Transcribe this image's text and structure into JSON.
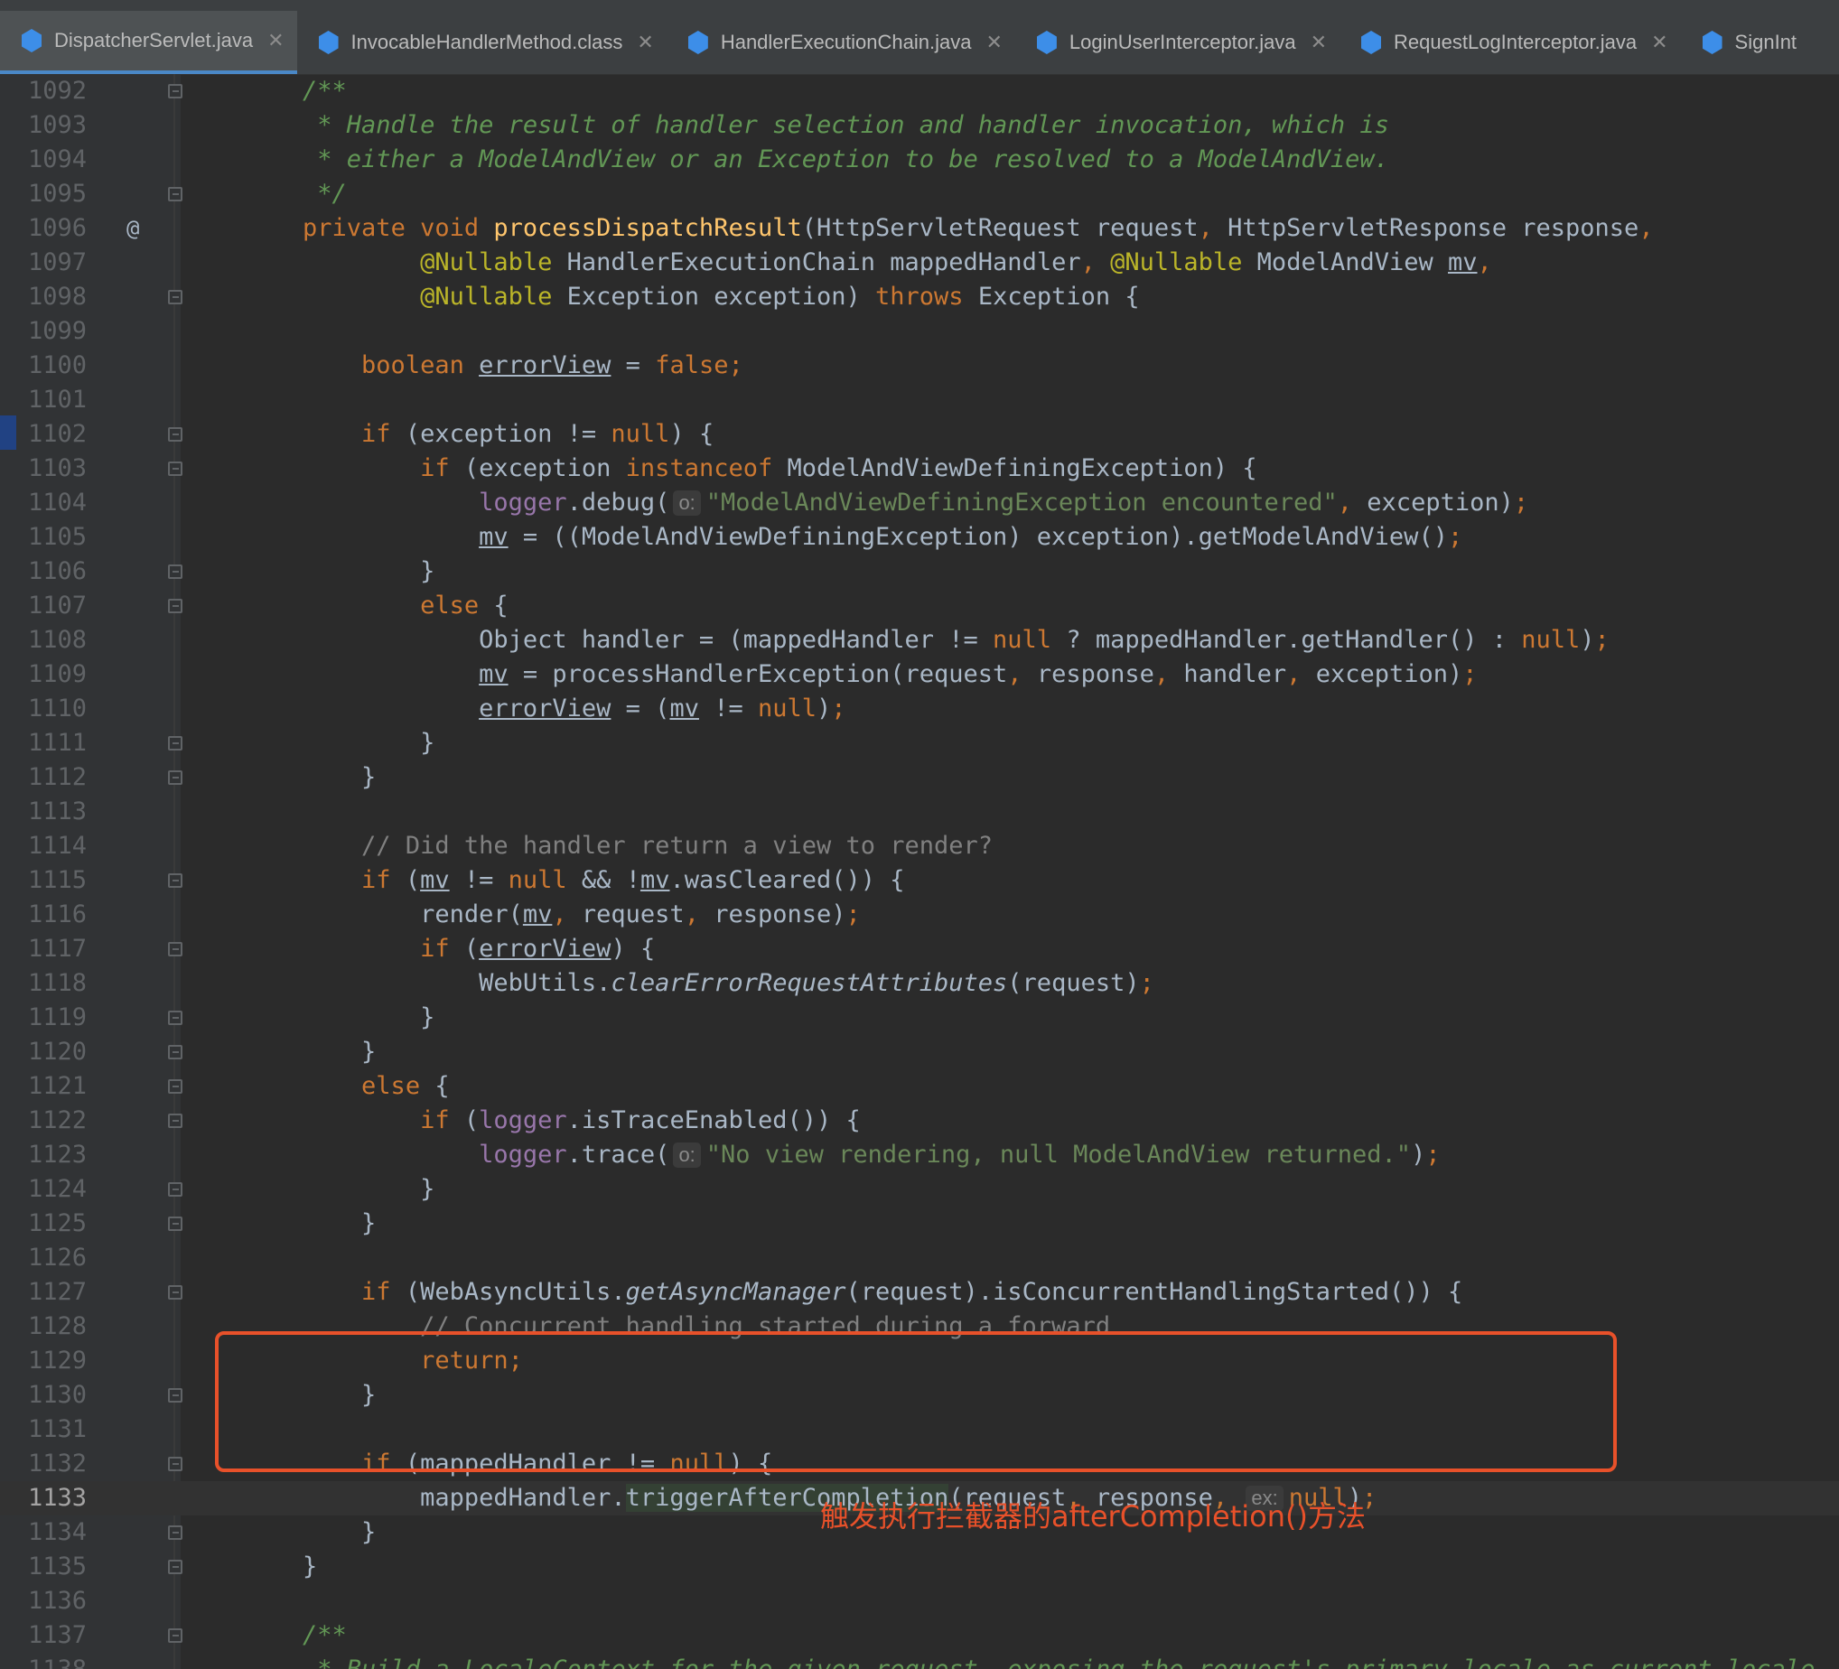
{
  "tabs": [
    {
      "label": "DispatcherServlet.java",
      "active": true,
      "closable": true
    },
    {
      "label": "InvocableHandlerMethod.class",
      "active": false,
      "closable": true
    },
    {
      "label": "HandlerExecutionChain.java",
      "active": false,
      "closable": true
    },
    {
      "label": "LoginUserInterceptor.java",
      "active": false,
      "closable": true
    },
    {
      "label": "RequestLogInterceptor.java",
      "active": false,
      "closable": true
    },
    {
      "label": "SignInt",
      "active": false,
      "closable": false
    }
  ],
  "editor": {
    "current_line": 1133,
    "lines": [
      {
        "n": "1092",
        "fold": true,
        "html": "    <span class=\"jd\">/**</span>"
      },
      {
        "n": "1093",
        "fold": false,
        "html": "     <span class=\"jd\">* Handle the result of handler selection and handler invocation, which is</span>"
      },
      {
        "n": "1094",
        "fold": false,
        "html": "     <span class=\"jd\">* either a ModelAndView or an Exception to be resolved to a ModelAndView.</span>"
      },
      {
        "n": "1095",
        "fold": true,
        "html": "     <span class=\"jd\">*/</span>"
      },
      {
        "n": "1096",
        "fold": false,
        "at": "@",
        "html": "    <span class=\"kw\">private void </span><span class=\"fn\">processDispatchResult</span>(HttpServletRequest request<span class=\"kw\">, </span>HttpServletResponse response<span class=\"kw\">,</span>"
      },
      {
        "n": "1097",
        "fold": false,
        "html": "            <span class=\"an\">@Nullable</span> HandlerExecutionChain mappedHandler<span class=\"kw\">, </span><span class=\"an\">@Nullable</span> ModelAndView <span class=\"ul\">mv</span><span class=\"kw\">,</span>"
      },
      {
        "n": "1098",
        "fold": true,
        "html": "            <span class=\"an\">@Nullable</span> Exception exception) <span class=\"kw\">throws </span>Exception {"
      },
      {
        "n": "1099",
        "fold": false,
        "html": ""
      },
      {
        "n": "1100",
        "fold": false,
        "html": "        <span class=\"kw\">boolean </span><span class=\"ul\">errorView</span> = <span class=\"kw\">false;</span>"
      },
      {
        "n": "1101",
        "fold": false,
        "html": ""
      },
      {
        "n": "1102",
        "fold": true,
        "html": "        <span class=\"kw\">if </span>(exception != <span class=\"kw\">null</span>) {"
      },
      {
        "n": "1103",
        "fold": true,
        "html": "            <span class=\"kw\">if </span>(exception <span class=\"kw\">instanceof </span>ModelAndViewDefiningException) {"
      },
      {
        "n": "1104",
        "fold": false,
        "html": "                <span class=\"fd\">logger</span>.debug(<span class=\"hint\">o:</span><span class=\"st\">\"ModelAndViewDefiningException encountered\"</span><span class=\"kw\">, </span>exception)<span class=\"kw\">;</span>"
      },
      {
        "n": "1105",
        "fold": false,
        "html": "                <span class=\"ul\">mv</span> = ((ModelAndViewDefiningException) exception).getModelAndView()<span class=\"kw\">;</span>"
      },
      {
        "n": "1106",
        "fold": true,
        "html": "            }"
      },
      {
        "n": "1107",
        "fold": true,
        "html": "            <span class=\"kw\">else </span>{"
      },
      {
        "n": "1108",
        "fold": false,
        "html": "                Object handler = (mappedHandler != <span class=\"kw\">null </span>? mappedHandler.getHandler() : <span class=\"kw\">null</span>)<span class=\"kw\">;</span>"
      },
      {
        "n": "1109",
        "fold": false,
        "html": "                <span class=\"ul\">mv</span> = processHandlerException(request<span class=\"kw\">, </span>response<span class=\"kw\">, </span>handler<span class=\"kw\">, </span>exception)<span class=\"kw\">;</span>"
      },
      {
        "n": "1110",
        "fold": false,
        "html": "                <span class=\"ul\">errorView</span> = (<span class=\"ul\">mv</span> != <span class=\"kw\">null</span>)<span class=\"kw\">;</span>"
      },
      {
        "n": "1111",
        "fold": true,
        "html": "            }"
      },
      {
        "n": "1112",
        "fold": true,
        "html": "        }"
      },
      {
        "n": "1113",
        "fold": false,
        "html": ""
      },
      {
        "n": "1114",
        "fold": false,
        "html": "        <span class=\"cm\">// Did the handler return a view to render?</span>"
      },
      {
        "n": "1115",
        "fold": true,
        "html": "        <span class=\"kw\">if </span>(<span class=\"ul\">mv</span> != <span class=\"kw\">null </span>&amp;&amp; !<span class=\"ul\">mv</span>.wasCleared()) {"
      },
      {
        "n": "1116",
        "fold": false,
        "html": "            render(<span class=\"ul\">mv</span><span class=\"kw\">, </span>request<span class=\"kw\">, </span>response)<span class=\"kw\">;</span>"
      },
      {
        "n": "1117",
        "fold": true,
        "html": "            <span class=\"kw\">if </span>(<span class=\"ul\">errorView</span>) {"
      },
      {
        "n": "1118",
        "fold": false,
        "html": "                WebUtils.<span class=\"it\">clearErrorRequestAttributes</span>(request)<span class=\"kw\">;</span>"
      },
      {
        "n": "1119",
        "fold": true,
        "html": "            }"
      },
      {
        "n": "1120",
        "fold": true,
        "html": "        }"
      },
      {
        "n": "1121",
        "fold": true,
        "html": "        <span class=\"kw\">else </span>{"
      },
      {
        "n": "1122",
        "fold": true,
        "html": "            <span class=\"kw\">if </span>(<span class=\"fd\">logger</span>.isTraceEnabled()) {"
      },
      {
        "n": "1123",
        "fold": false,
        "html": "                <span class=\"fd\">logger</span>.trace(<span class=\"hint\">o:</span><span class=\"st\">\"No view rendering, null ModelAndView returned.\"</span>)<span class=\"kw\">;</span>"
      },
      {
        "n": "1124",
        "fold": true,
        "html": "            }"
      },
      {
        "n": "1125",
        "fold": true,
        "html": "        }"
      },
      {
        "n": "1126",
        "fold": false,
        "html": ""
      },
      {
        "n": "1127",
        "fold": true,
        "html": "        <span class=\"kw\">if </span>(WebAsyncUtils.<span class=\"it\">getAsyncManager</span>(request).isConcurrentHandlingStarted()) {"
      },
      {
        "n": "1128",
        "fold": false,
        "html": "            <span class=\"cm\">// Concurrent handling started during a forward</span>"
      },
      {
        "n": "1129",
        "fold": false,
        "html": "            <span class=\"kw\">return;</span>"
      },
      {
        "n": "1130",
        "fold": true,
        "html": "        }"
      },
      {
        "n": "1131",
        "fold": false,
        "html": ""
      },
      {
        "n": "1132",
        "fold": true,
        "html": "        <span class=\"kw\">if </span>(mappedHandler != <span class=\"kw\">null</span>) {"
      },
      {
        "n": "1133",
        "fold": false,
        "html": "            mappedHandler.<span class=\"hlbg\">triggerAfterCompletion</span>(request<span class=\"kw\">, </span>response<span class=\"kw\">, </span><span class=\"hint\">ex:</span><span class=\"kw\">null</span>)<span class=\"kw\">;</span>"
      },
      {
        "n": "1134",
        "fold": true,
        "html": "        }"
      },
      {
        "n": "1135",
        "fold": true,
        "html": "    }"
      },
      {
        "n": "1136",
        "fold": false,
        "html": ""
      },
      {
        "n": "1137",
        "fold": true,
        "html": "    <span class=\"jd\">/**</span>"
      },
      {
        "n": "1138",
        "fold": false,
        "html": "     <span class=\"jd\">* Build a LocaleContext for the given request, exposing the request's primary locale as current locale.</span>"
      }
    ]
  },
  "annotation": {
    "text": "触发执行拦截器的afterCompletion()方法",
    "color": "#e8512a"
  }
}
